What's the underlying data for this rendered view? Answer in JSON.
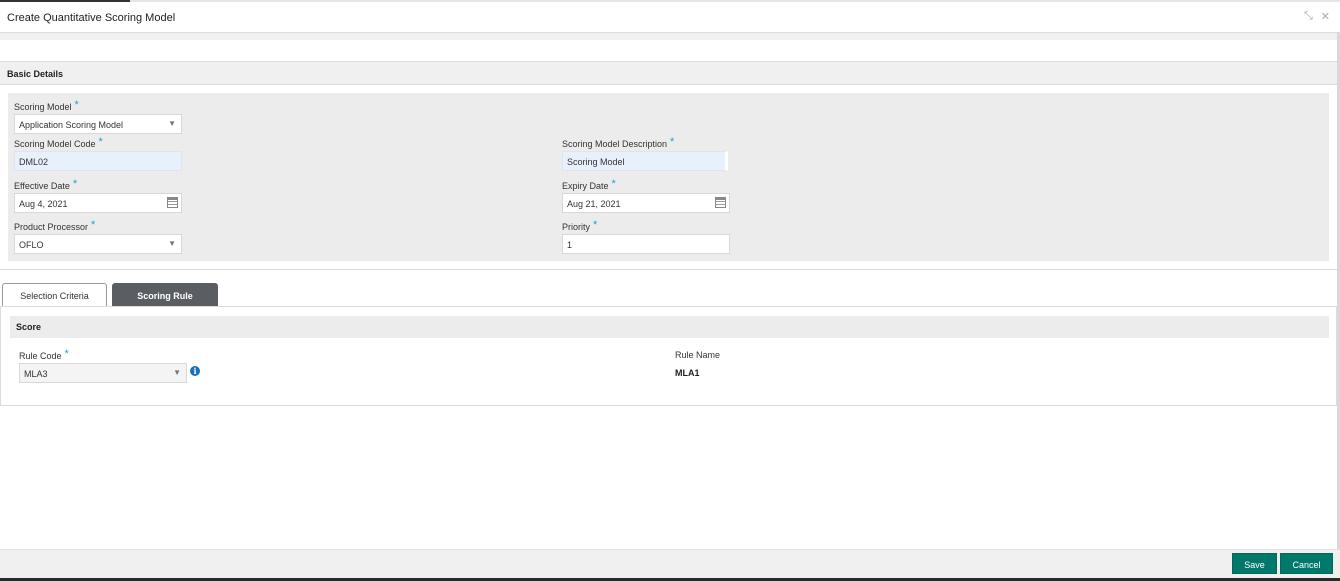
{
  "window": {
    "title": "Create Quantitative Scoring Model"
  },
  "basic_details": {
    "section_title": "Basic Details",
    "scoring_model": {
      "label": "Scoring Model",
      "value": "Application Scoring Model"
    },
    "scoring_model_code": {
      "label": "Scoring Model Code",
      "value": "DML02"
    },
    "scoring_model_description": {
      "label": "Scoring Model Description",
      "value": "Scoring Model"
    },
    "effective_date": {
      "label": "Effective Date",
      "value": "Aug 4, 2021"
    },
    "expiry_date": {
      "label": "Expiry Date",
      "value": "Aug 21, 2021"
    },
    "product_processor": {
      "label": "Product Processor",
      "value": "OFLO"
    },
    "priority": {
      "label": "Priority",
      "value": "1"
    },
    "required_marker": "*"
  },
  "tabs": [
    {
      "label": "Selection Criteria",
      "active": false
    },
    {
      "label": "Scoring Rule",
      "active": true
    }
  ],
  "score": {
    "section_title": "Score",
    "rule_code": {
      "label": "Rule Code",
      "value": "MLA3"
    },
    "rule_name": {
      "label": "Rule Name",
      "value": "MLA1"
    }
  },
  "footer": {
    "save_label": "Save",
    "cancel_label": "Cancel"
  },
  "icons": {
    "minimize": "minimize-icon",
    "close": "close-icon",
    "dropdown": "chevron-down-icon",
    "calendar": "calendar-icon",
    "info": "info-icon"
  },
  "colors": {
    "accent": "#00796b",
    "required": "#1a9fd6",
    "active_tab": "#5a5e63",
    "info": "#1a6fb5"
  }
}
